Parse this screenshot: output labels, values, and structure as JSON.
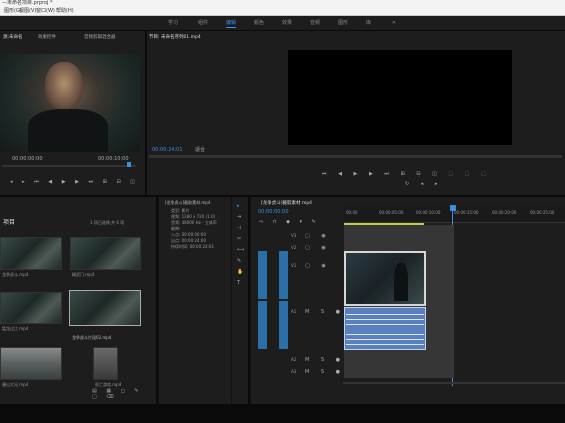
{
  "titlebar": {
    "title": "—未命名项目.prproj *"
  },
  "menubar": {
    "items": [
      "图形(G)",
      "视图(V)",
      "窗口(W)",
      "帮助(H)"
    ]
  },
  "workspaces": {
    "items": [
      "学习",
      "组件",
      "编辑",
      "颜色",
      "效果",
      "音频",
      "图形",
      "库"
    ],
    "active_index": 2
  },
  "source_panel": {
    "tabs": [
      "源:未命名",
      "效果控件",
      "音频剪辑混合器"
    ],
    "timecode_left": "00:00:00:00",
    "timecode_right": "00:00:10:00"
  },
  "program_panel": {
    "tab": "节目: 未命名序列01.mp4",
    "timecode": "00:00:24:01",
    "fit_label": "适合"
  },
  "project_panel": {
    "tab": "项目",
    "item_count": "1 项已选择,共 6 项",
    "clips": [
      {
        "label": "龙争虎斗.mp4"
      },
      {
        "label": "精武门.mp4"
      },
      {
        "label": "猛龙过江.mp4"
      },
      {
        "label": "龙争虎斗片段02.mp4"
      },
      {
        "label": "唐山大兄.mp4"
      },
      {
        "label": "死亡游戏.mp4"
      }
    ]
  },
  "info_panel": {
    "title": "[龙争虎斗]截取素材.mp4",
    "rows": [
      "类型: 影片",
      "视频: 1280 x 720 (1.0)",
      "音频: 48000 Hz - 立体声",
      "磁带:",
      "入点: 00:00:00:00",
      "出点: 00:00:24:00",
      "持续时间: 00:00:24:01"
    ]
  },
  "timeline": {
    "tab": "[龙争虎斗]截取素材.mp4",
    "timecode": "00:00:00:00",
    "ruler": [
      "00:00",
      "00:00:05:00",
      "00:00:10:00",
      "00:00:15:00",
      "00:00:20:00",
      "00:00:25:00",
      "00:00:30:00"
    ],
    "tracks": [
      "V3",
      "V2",
      "V1",
      "A1",
      "A2",
      "A3"
    ]
  },
  "colors": {
    "accent": "#3c8ee6",
    "track_blue": "#2b6ea8",
    "audio_clip": "#5a7fbf"
  }
}
